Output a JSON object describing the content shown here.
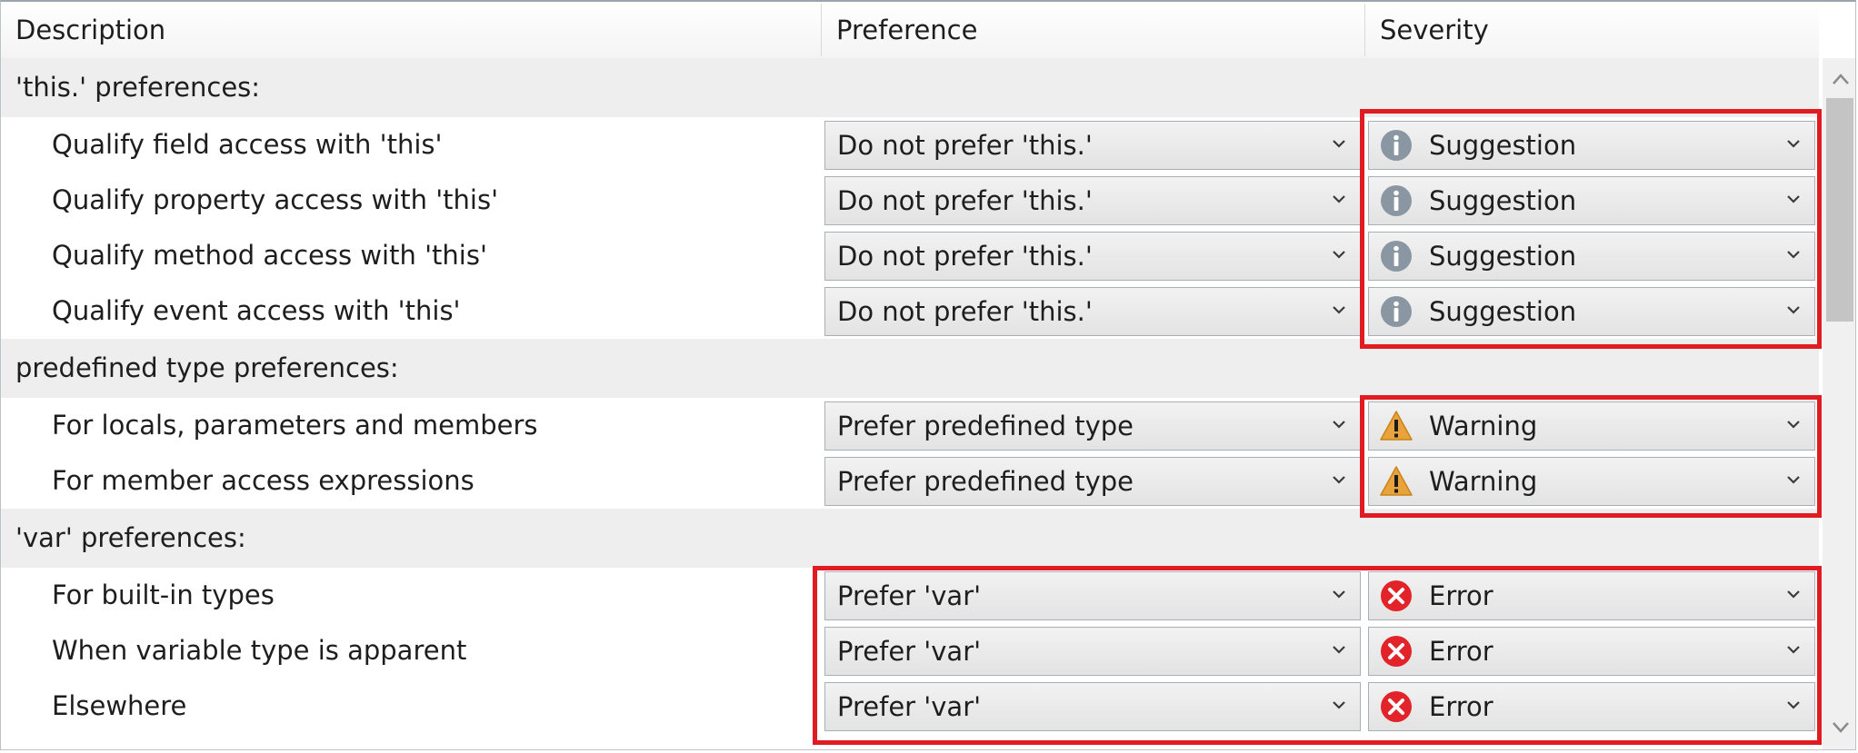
{
  "header": {
    "description": "Description",
    "preference": "Preference",
    "severity": "Severity"
  },
  "groups": [
    {
      "label": "'this.' preferences:",
      "items": [
        {
          "description": "Qualify field access with 'this'",
          "preference": "Do not prefer 'this.'",
          "severity": "Suggestion",
          "severity_icon": "info-icon"
        },
        {
          "description": "Qualify property access with 'this'",
          "preference": "Do not prefer 'this.'",
          "severity": "Suggestion",
          "severity_icon": "info-icon"
        },
        {
          "description": "Qualify method access with 'this'",
          "preference": "Do not prefer 'this.'",
          "severity": "Suggestion",
          "severity_icon": "info-icon"
        },
        {
          "description": "Qualify event access with 'this'",
          "preference": "Do not prefer 'this.'",
          "severity": "Suggestion",
          "severity_icon": "info-icon"
        }
      ]
    },
    {
      "label": "predefined type preferences:",
      "items": [
        {
          "description": "For locals, parameters and members",
          "preference": "Prefer predefined type",
          "severity": "Warning",
          "severity_icon": "warning-icon"
        },
        {
          "description": "For member access expressions",
          "preference": "Prefer predefined type",
          "severity": "Warning",
          "severity_icon": "warning-icon"
        }
      ]
    },
    {
      "label": "'var' preferences:",
      "items": [
        {
          "description": "For built-in types",
          "preference": "Prefer 'var'",
          "severity": "Error",
          "severity_icon": "error-icon"
        },
        {
          "description": "When variable type is apparent",
          "preference": "Prefer 'var'",
          "severity": "Error",
          "severity_icon": "error-icon"
        },
        {
          "description": "Elsewhere",
          "preference": "Prefer 'var'",
          "severity": "Error",
          "severity_icon": "error-icon"
        }
      ]
    }
  ],
  "colors": {
    "highlight": "#e11b22",
    "info": "#8a97a3",
    "warning": "#e8a33d",
    "error": "#e3232a"
  }
}
